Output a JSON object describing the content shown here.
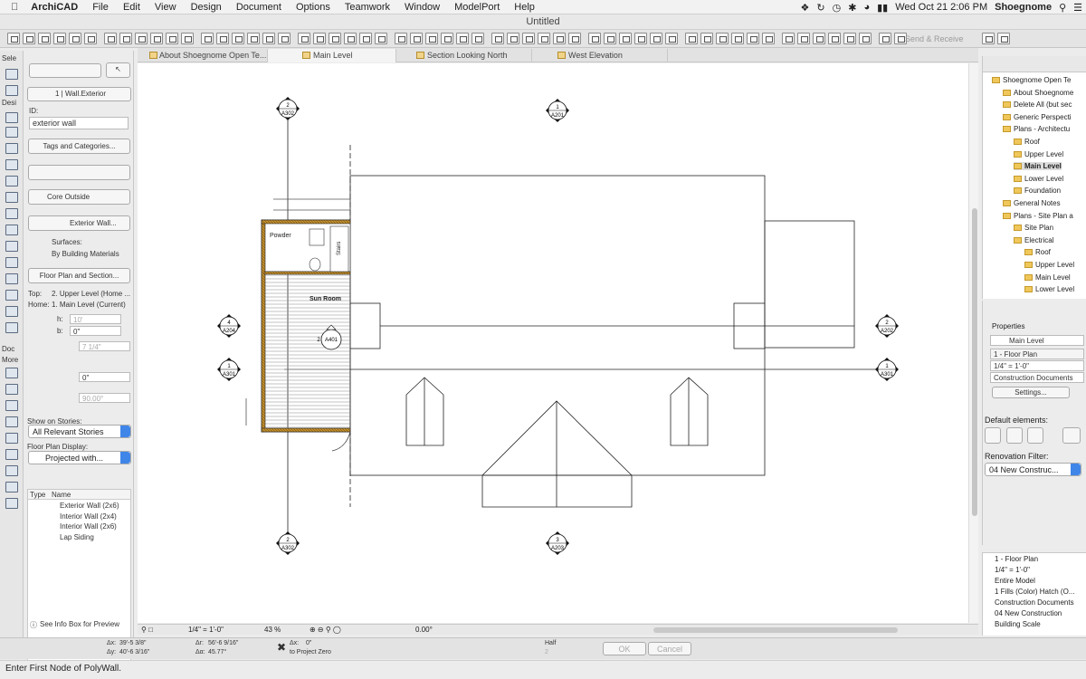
{
  "menubar": {
    "apple": "",
    "app_name": "ArchiCAD",
    "items": [
      "File",
      "Edit",
      "View",
      "Design",
      "Document",
      "Options",
      "Teamwork",
      "Window",
      "ModelPort",
      "Help"
    ],
    "status": {
      "datetime": "Wed Oct 21  2:06 PM",
      "user": "Shoegnome"
    }
  },
  "window": {
    "title": "Untitled"
  },
  "toolbar": {
    "send_receive": "Send & Receive"
  },
  "toolbox": {
    "select": "Sele",
    "design": "Desi",
    "doc": "Doc",
    "more": "More"
  },
  "infobox": {
    "layer_label": "1 | Wall.Exterior",
    "id_label": "ID:",
    "id_value": "exterior wall",
    "tags_button": "Tags and Categories...",
    "core_outside": "Core Outside",
    "material": "Exterior Wall...",
    "surfaces_label": "Surfaces:",
    "surfaces_value": "By Building Materials",
    "floor_plan_section": "Floor Plan and Section...",
    "top_label": "Top:",
    "top_value": "2. Upper Level (Home ...",
    "home_label": "Home:",
    "home_value": "1. Main Level (Current)",
    "h_label": "h:",
    "h_value": "10'",
    "b_label": "b:",
    "b_value": "0\"",
    "thickness_value": "7 1/4\"",
    "offset_value": "0\"",
    "angle_value": "90.00°",
    "show_on_stories_label": "Show on Stories:",
    "show_on_stories_value": "All Relevant Stories",
    "floor_plan_display_label": "Floor Plan Display:",
    "floor_plan_display_value": "Projected with...",
    "table_type": "Type",
    "table_name": "Name",
    "table_rows": [
      "Exterior Wall (2x6)",
      "Interior Wall (2x4)",
      "Interior Wall (2x6)",
      "Lap Siding"
    ],
    "see_info_box": "See Info Box for Preview"
  },
  "tabs": [
    {
      "label": "About Shoegnome Open Te..."
    },
    {
      "label": "Main Level"
    },
    {
      "label": "Section Looking North"
    },
    {
      "label": "West Elevation"
    }
  ],
  "drawing": {
    "room_powder": "Powder",
    "room_sun": "Sun Room",
    "room_stairs": "Stairs",
    "markers": [
      {
        "top": "2",
        "bottom": "A302"
      },
      {
        "top": "1",
        "bottom": "A201"
      },
      {
        "top": "4",
        "bottom": "A204"
      },
      {
        "top": "1",
        "bottom": "A301"
      },
      {
        "top": "2",
        "bottom": "A202"
      },
      {
        "top": "1",
        "bottom": "A301"
      },
      {
        "top": "2",
        "bottom": "A302"
      },
      {
        "top": "3",
        "bottom": "A203"
      },
      {
        "top": "2",
        "bottom": "A401"
      }
    ]
  },
  "viewbar": {
    "scale": "1/4\"   =   1'-0\"",
    "zoom": "43 %",
    "angle": "0.00°"
  },
  "navigator": {
    "items": [
      {
        "label": "Shoegnome Open Te",
        "selected": false
      },
      {
        "label": "About Shoegnome",
        "selected": false
      },
      {
        "label": "Delete All (but sec",
        "selected": false
      },
      {
        "label": "Generic Perspecti",
        "selected": false
      },
      {
        "label": "Plans - Architectu",
        "selected": false
      },
      {
        "label": "Roof",
        "selected": false
      },
      {
        "label": "Upper Level",
        "selected": false
      },
      {
        "label": "Main Level",
        "selected": true
      },
      {
        "label": "Lower Level",
        "selected": false
      },
      {
        "label": "Foundation",
        "selected": false
      },
      {
        "label": "General Notes",
        "selected": false
      },
      {
        "label": "Plans - Site Plan a",
        "selected": false
      },
      {
        "label": "Site Plan",
        "selected": false
      },
      {
        "label": "Electrical",
        "selected": false
      },
      {
        "label": "Roof",
        "selected": false
      },
      {
        "label": "Upper Level",
        "selected": false
      },
      {
        "label": "Main Level",
        "selected": false
      },
      {
        "label": "Lower Level",
        "selected": false
      }
    ]
  },
  "properties": {
    "header": "Properties",
    "name": "Main Level",
    "view_type": "1 - Floor Plan",
    "scale": "1/4\"   =   1'-0\"",
    "layer_set": "Construction Documents",
    "settings_button": "Settings...",
    "default_elements": "Default elements:",
    "renovation_filter_label": "Renovation Filter:",
    "renovation_filter_value": "04 New Construc..."
  },
  "quick_options": [
    "1 - Floor Plan",
    "1/4\"   =   1'-0\"",
    "Entire Model",
    "1 Fills (Color) Hatch (O...",
    "Construction Documents",
    "04 New Construction",
    "Building Scale"
  ],
  "coords": {
    "dx": "39'-5 3/8\"",
    "dy": "40'-6 3/16\"",
    "dr": "56'-6 9/16\"",
    "da": "45.77°",
    "project_zero": "to Project Zero",
    "x_val": "0\"",
    "half": "Half",
    "half_n": "2",
    "ok": "OK",
    "cancel": "Cancel"
  },
  "status": "Enter First Node of PolyWall."
}
